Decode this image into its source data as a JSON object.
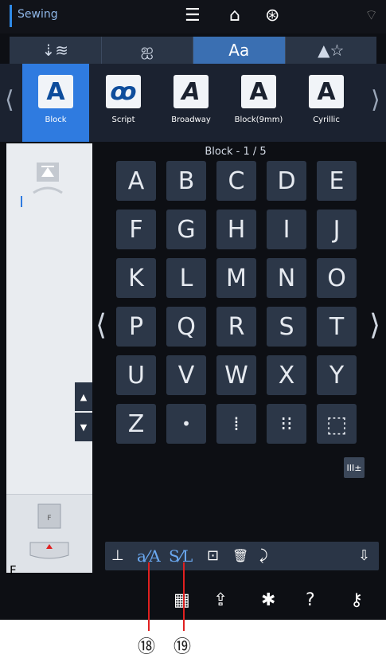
{
  "topbar": {
    "title": "Sewing",
    "icons": [
      "menu-icon",
      "home-icon",
      "back-icon",
      "wifi-icon"
    ]
  },
  "categories": [
    {
      "label": "⇣≋",
      "icon": "utility-stitch-icon"
    },
    {
      "label": "ஐ",
      "icon": "decorative-stitch-icon"
    },
    {
      "label": "Aa",
      "icon": "alphabet-icon"
    },
    {
      "label": "▲☆",
      "icon": "favorites-icon"
    }
  ],
  "fonts": [
    {
      "glyph": "A",
      "label": "Block"
    },
    {
      "glyph": "ꝏ",
      "label": "Script"
    },
    {
      "glyph": "A",
      "label": "Broadway"
    },
    {
      "glyph": "A",
      "label": "Block(9mm)"
    },
    {
      "glyph": "A",
      "label": "Cyrillic"
    }
  ],
  "grid": {
    "title": "Block - 1 / 5",
    "keys": [
      "A",
      "B",
      "C",
      "D",
      "E",
      "F",
      "G",
      "H",
      "I",
      "J",
      "K",
      "L",
      "M",
      "N",
      "O",
      "P",
      "Q",
      "R",
      "S",
      "T",
      "U",
      "V",
      "W",
      "X",
      "Y",
      "Z",
      "•",
      "⁞",
      "⁝⁝",
      "⬚"
    ]
  },
  "left_panel": {
    "foot_label": "F"
  },
  "size_button": {
    "label": "III±"
  },
  "toolbar": {
    "items": [
      "⊥",
      "a⁄A",
      "S⁄L",
      "⊡",
      "🗑",
      "⤸",
      "⇩"
    ]
  },
  "bottom_bar": {
    "icons": [
      "memory-icon",
      "export-icon",
      "settings-icon",
      "help-icon",
      "key-icon"
    ]
  },
  "callouts": [
    "⑱",
    "⑲"
  ],
  "colors": {
    "accent": "#2f7be0",
    "panel": "#2a3546",
    "background": "#0d0f14"
  }
}
